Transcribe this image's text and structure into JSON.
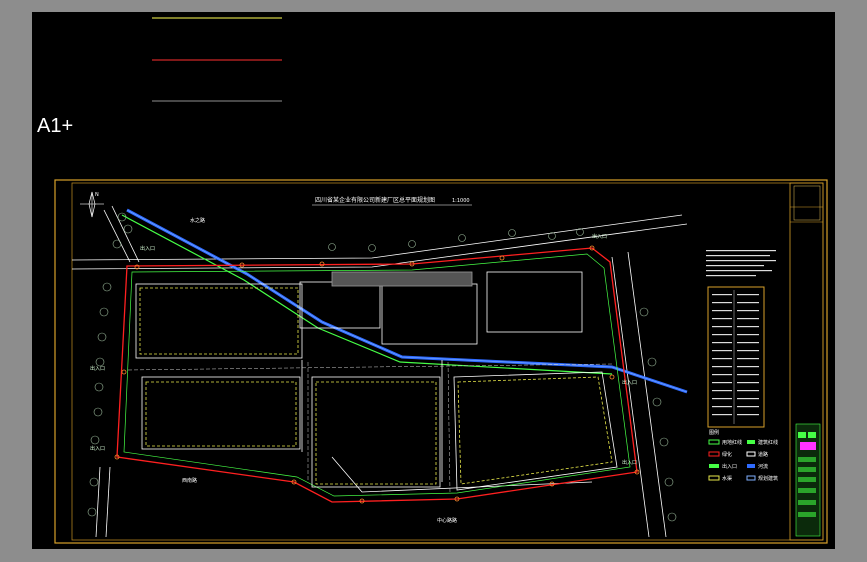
{
  "window": {
    "title": ""
  },
  "drawing": {
    "ucs_label": "A1+",
    "title": "四川省某企业有限公司新建厂区总平面规划图",
    "scale": "1:1000",
    "legend_title": "图例",
    "road_labels": {
      "south": "中心路路",
      "west": "西南路",
      "water": "水之路"
    },
    "gate_labels": [
      "出入口",
      "出入口",
      "出入口",
      "出入口",
      "出入口",
      "出入口"
    ],
    "colors": {
      "frame": "#d7a12a",
      "boundary": "#ff2020",
      "road": "#ffffff",
      "green": "#46ff46",
      "water": "#2f6bff",
      "building": "#e8e84a",
      "trees": "#9ab89a"
    },
    "legend_items": [
      "用地红线",
      "建筑红线",
      "绿化",
      "道路",
      "出入口",
      "河流",
      "水渠",
      "规划建筑"
    ],
    "header_lines": [
      {
        "color": "#ffff55"
      },
      {
        "color": "#ff3030"
      },
      {
        "color": "#909090"
      }
    ]
  }
}
